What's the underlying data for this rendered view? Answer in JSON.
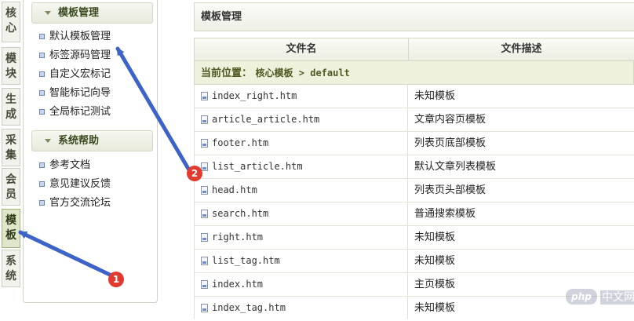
{
  "vtabs": [
    {
      "label1": "核",
      "label2": "心"
    },
    {
      "label1": "模",
      "label2": "块"
    },
    {
      "label1": "生",
      "label2": "成"
    },
    {
      "label1": "采",
      "label2": "集"
    },
    {
      "label1": "会",
      "label2": "员"
    },
    {
      "label1": "模",
      "label2": "板"
    },
    {
      "label1": "系",
      "label2": "统"
    }
  ],
  "menu": {
    "section1": {
      "title": "模板管理",
      "items": [
        "默认模板管理",
        "标签源码管理",
        "自定义宏标记",
        "智能标记向导",
        "全局标记测试"
      ]
    },
    "section2": {
      "title": "系统帮助",
      "items": [
        "参考文档",
        "意见建议反馈",
        "官方交流论坛"
      ]
    }
  },
  "main": {
    "title": "模板管理",
    "columns": [
      "文件名",
      "文件描述"
    ],
    "location_label": "当前位置：",
    "location_path": "核心模板 > default",
    "rows": [
      {
        "file": "index_right.htm",
        "desc": "未知模板"
      },
      {
        "file": "article_article.htm",
        "desc": "文章内容页模板"
      },
      {
        "file": "footer.htm",
        "desc": "列表页底部模板"
      },
      {
        "file": "list_article.htm",
        "desc": "默认文章列表模板"
      },
      {
        "file": "head.htm",
        "desc": "列表页头部模板"
      },
      {
        "file": "search.htm",
        "desc": "普通搜索模板"
      },
      {
        "file": "right.htm",
        "desc": "未知模板"
      },
      {
        "file": "list_tag.htm",
        "desc": "未知模板"
      },
      {
        "file": "index.htm",
        "desc": "主页模板"
      },
      {
        "file": "index_tag.htm",
        "desc": "未知模板"
      }
    ]
  },
  "annotations": {
    "badge1": "1",
    "badge2": "2"
  },
  "watermark": {
    "logo": "php",
    "text": "中文网"
  },
  "colors": {
    "accent_arrow": "#3d63c9",
    "badge": "#e23a2e",
    "location_bg": "#eef1dc"
  }
}
